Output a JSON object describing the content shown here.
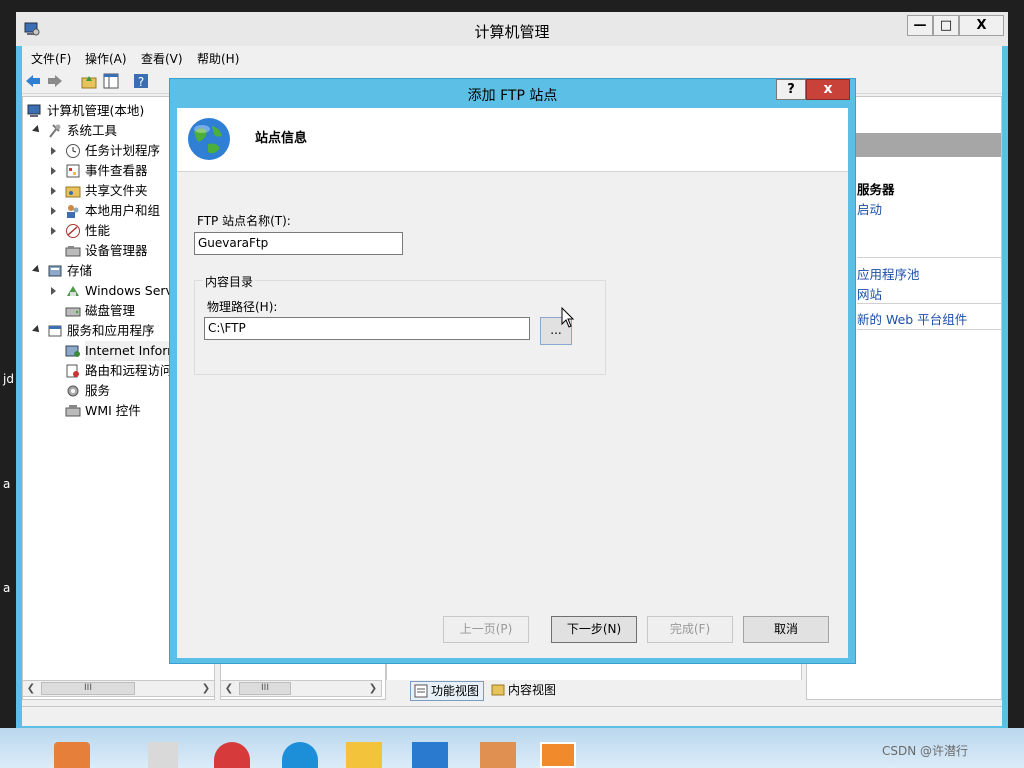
{
  "window": {
    "title": "计算机管理"
  },
  "window_buttons": {
    "minimize": "—",
    "maximize": "□",
    "close": "X"
  },
  "menu": [
    "文件(F)",
    "操作(A)",
    "查看(V)",
    "帮助(H)"
  ],
  "tree": {
    "root": "计算机管理(本地)",
    "items": [
      "系统工具",
      "任务计划程序",
      "事件查看器",
      "共享文件夹",
      "本地用户和组",
      "性能",
      "设备管理器",
      "存储",
      "Windows Serve",
      "磁盘管理",
      "服务和应用程序",
      "Internet Inforn",
      "路由和远程访问",
      "服务",
      "WMI 控件"
    ]
  },
  "actions": {
    "header": "服务器",
    "items": [
      "启动",
      "应用程序池",
      "网站",
      "新的 Web 平台组件"
    ]
  },
  "bottom_tabs": [
    "功能视图",
    "内容视图"
  ],
  "desktop_fragments": [
    "jd",
    "a",
    "a"
  ],
  "dialog": {
    "title": "添加 FTP 站点",
    "help": "?",
    "close": "x",
    "header": "站点信息",
    "site_name_label": "FTP 站点名称(T):",
    "site_name_value": "GuevaraFtp",
    "content_group": "内容目录",
    "path_label": "物理路径(H):",
    "path_value": "C:\\FTP",
    "browse": "...",
    "buttons": {
      "prev": "上一页(P)",
      "next": "下一步(N)",
      "finish": "完成(F)",
      "cancel": "取消"
    }
  },
  "taskbar": {
    "watermark": "CSDN @许潜行"
  }
}
